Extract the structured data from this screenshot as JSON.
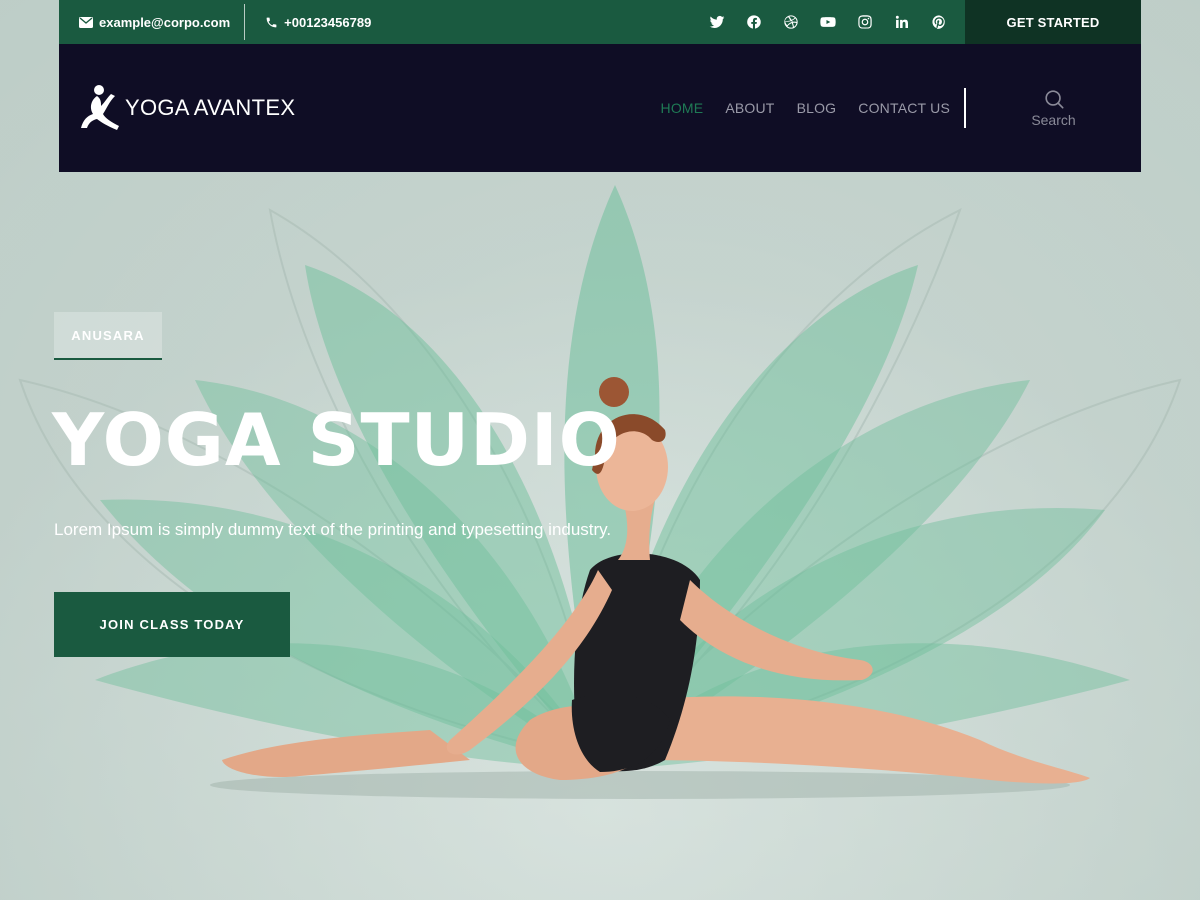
{
  "topbar": {
    "email": "example@corpo.com",
    "phone": "+00123456789",
    "social": [
      "twitter-icon",
      "facebook-icon",
      "dribbble-icon",
      "youtube-icon",
      "instagram-icon",
      "linkedin-icon",
      "pinterest-icon"
    ],
    "cta_label": "GET STARTED"
  },
  "nav": {
    "logo_text": "YOGA AVANTEX",
    "menu": [
      {
        "label": "HOME",
        "active": true
      },
      {
        "label": "ABOUT",
        "active": false
      },
      {
        "label": "BLOG",
        "active": false
      },
      {
        "label": "CONTACT US",
        "active": false
      }
    ],
    "search_label": "Search"
  },
  "hero": {
    "tag": "ANUSARA",
    "title": "YOGA STUDIO",
    "subtitle": "Lorem Ipsum is simply dummy text of the printing and typesetting industry.",
    "button_label": "JOIN CLASS TODAY"
  },
  "colors": {
    "brand_green": "#1a5a40",
    "dark_green": "#0f3324",
    "nav_bg": "#0f0d25",
    "active_menu": "#1f7a55",
    "lotus": "#6fbf9c"
  }
}
